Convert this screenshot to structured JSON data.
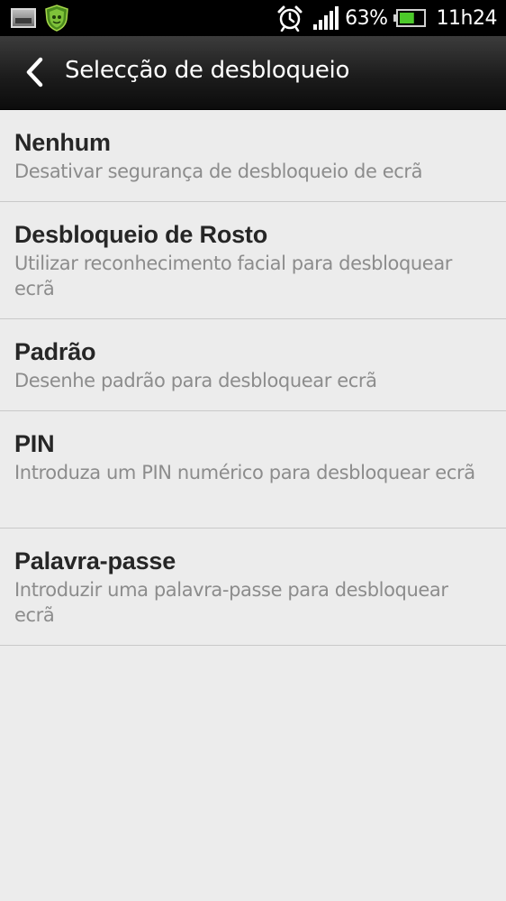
{
  "status_bar": {
    "battery_percent": "63%",
    "time": "11h24",
    "icons": {
      "left": [
        "gallery-notification-icon",
        "security-shield-icon"
      ],
      "right": [
        "alarm-clock-icon",
        "signal-strength-icon",
        "battery-icon"
      ]
    },
    "battery_level": 0.63,
    "battery_color": "#4cc92a"
  },
  "header": {
    "back_icon": "chevron-left-icon",
    "title": "Selecção de desbloqueio"
  },
  "options": [
    {
      "title": "Nenhum",
      "description": "Desativar segurança de desbloqueio de ecrã"
    },
    {
      "title": "Desbloqueio de Rosto",
      "description": "Utilizar reconhecimento facial para desbloquear ecrã"
    },
    {
      "title": "Padrão",
      "description": "Desenhe padrão para desbloquear ecrã"
    },
    {
      "title": "PIN",
      "description": "Introduza um PIN numérico para desbloquear ecrã"
    },
    {
      "title": "Palavra-passe",
      "description": "Introduzir uma palavra-passe para desbloquear ecrã"
    }
  ],
  "colors": {
    "background": "#ececec",
    "header": "#1c1c1c",
    "title_text": "#262626",
    "description_text": "#8c8c8c",
    "divider": "#c9c9c9"
  }
}
